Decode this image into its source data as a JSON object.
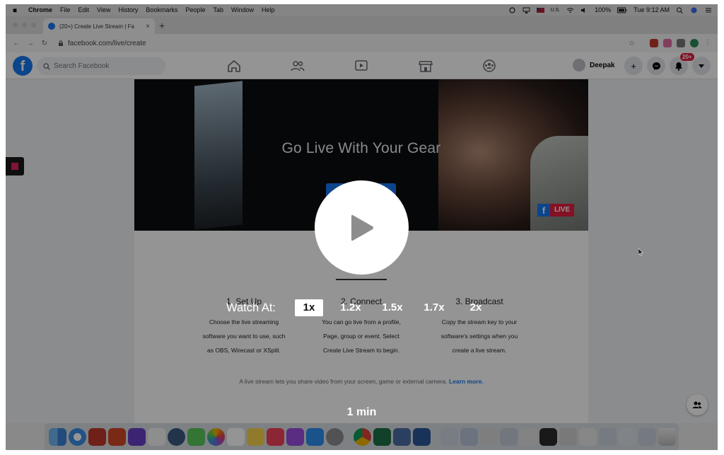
{
  "menubar": {
    "items": [
      "Chrome",
      "File",
      "Edit",
      "View",
      "History",
      "Bookmarks",
      "People",
      "Tab",
      "Window",
      "Help"
    ],
    "input_source": "U.S.",
    "battery": "100%",
    "clock": "Tue 9:12 AM"
  },
  "browser": {
    "tab_title": "(20+) Create Live Stream | Fa",
    "url": "facebook.com/live/create"
  },
  "facebook": {
    "logo_letter": "f",
    "search_placeholder": "Search Facebook",
    "user_name": "Deepak",
    "notification_badge": "20+",
    "brand_color": "#1877f2"
  },
  "hero": {
    "heading": "Go Live With Your Gear",
    "live_badge": "LIVE"
  },
  "steps": [
    {
      "title": "1. Set Up",
      "lines": [
        "Choose the live streaming",
        "software you want to use, such",
        "as OBS, Wirecast or XSplit."
      ]
    },
    {
      "title": "2. Connect",
      "lines": [
        "You can go live from a profile,",
        "Page, group or event. Select",
        "Create Live Stream to begin."
      ]
    },
    {
      "title": "3. Broadcast",
      "lines": [
        "Copy the stream key to your",
        "software's settings when you",
        "create a live stream."
      ]
    }
  ],
  "footer": {
    "text": "A live stream lets you share video from your screen, game or external camera.",
    "link": "Learn more."
  },
  "overlay": {
    "watch_label": "Watch At:",
    "speeds": [
      "1x",
      "1.2x",
      "1.5x",
      "1.7x",
      "2x"
    ],
    "selected_speed": "1x",
    "duration": "1 min"
  }
}
